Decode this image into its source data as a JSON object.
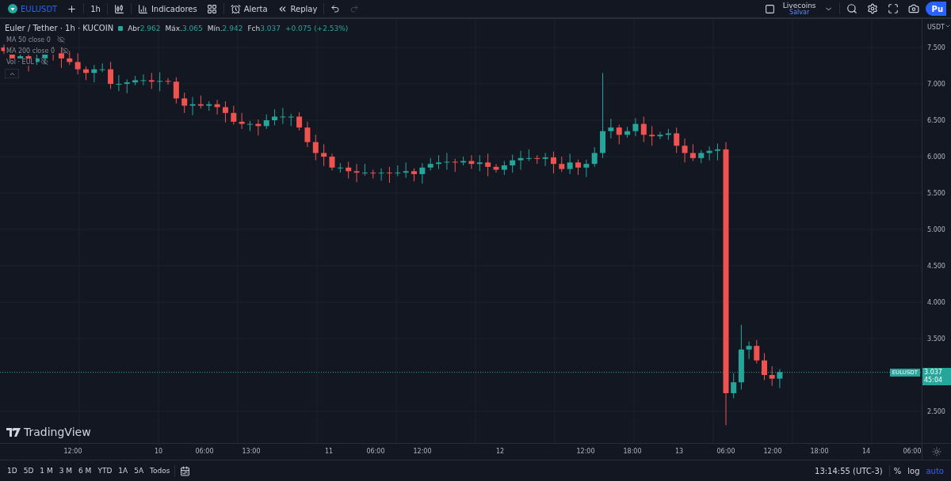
{
  "toolbar": {
    "symbol": "EULUSDT",
    "interval": "1h",
    "indicators": "Indicadores",
    "alert": "Alerta",
    "replay": "Replay",
    "redo_disabled": true,
    "layout_name": "Livecoins",
    "layout_status": "Salvar",
    "publish": "Pu"
  },
  "legend": {
    "title": "Euler / Tether · 1h · KUCOIN",
    "market_open": true,
    "values": [
      {
        "label": "Abr",
        "value": "2.962"
      },
      {
        "label": "Máx.",
        "value": "3.065"
      },
      {
        "label": "Mín.",
        "value": "2.942"
      },
      {
        "label": "Fch",
        "value": "3.037"
      }
    ],
    "change": "+0.075 (+2.53%)"
  },
  "studies": [
    {
      "name": "MA 50 close 0",
      "hidden": true
    },
    {
      "name": "MA 200 close 0",
      "hidden": true
    },
    {
      "name": "Vol · EUL",
      "hidden": true
    }
  ],
  "price_axis": {
    "currency": "USDT",
    "labels": [
      "7.500",
      "7.000",
      "6.500",
      "6.000",
      "5.500",
      "5.000",
      "4.500",
      "4.000",
      "3.500",
      "2.500"
    ],
    "last_symbol": "EULUSDT",
    "last_price": "3.037",
    "countdown": "45:04"
  },
  "watermark": "TradingView",
  "time_axis": [
    "12:00",
    "10",
    "06:00",
    "13:00",
    "11",
    "06:00",
    "12:00",
    "12",
    "12:00",
    "18:00",
    "13",
    "06:00",
    "12:00",
    "18:00",
    "14",
    "06:00"
  ],
  "ranges": [
    "1D",
    "5D",
    "1 M",
    "3 M",
    "6 M",
    "YTD",
    "1A",
    "5A",
    "Todos"
  ],
  "status": {
    "clock": "13:14:55 (UTC-3)",
    "modes": [
      {
        "label": "%",
        "selected": false
      },
      {
        "label": "log",
        "selected": false
      },
      {
        "label": "auto",
        "selected": true
      }
    ]
  }
}
